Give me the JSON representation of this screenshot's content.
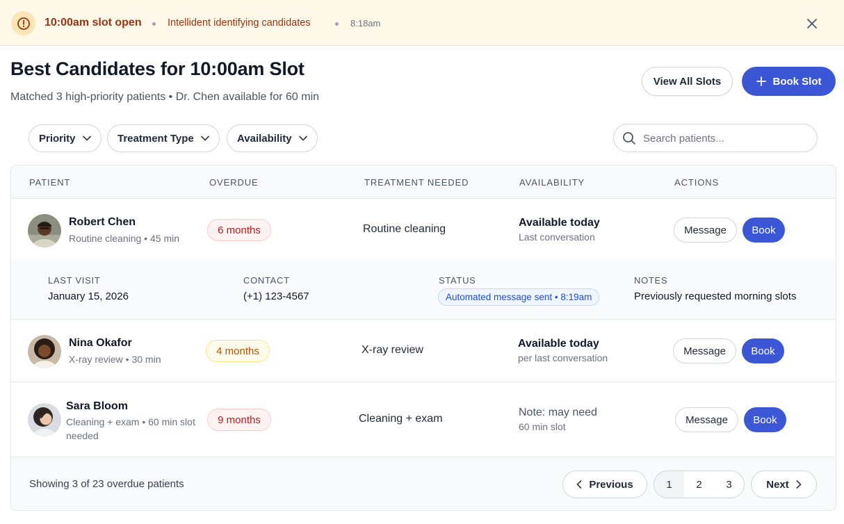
{
  "banner": {
    "title": "10:00am slot open",
    "subtitle": "Intellident identifying candidates",
    "time": "8:18am",
    "icon": "alert-circle-icon"
  },
  "header": {
    "title": "Best Candidates for 10:00am Slot",
    "subtitle": "Matched 3 high-priority patients • Dr. Chen available for 60 min",
    "view_all_label": "View All Slots",
    "book_slot_label": "Book Slot"
  },
  "filters": [
    {
      "label": "Priority"
    },
    {
      "label": "Treatment Type"
    },
    {
      "label": "Availability"
    }
  ],
  "search": {
    "placeholder": "Search patients..."
  },
  "table": {
    "columns": [
      "PATIENT",
      "OVERDUE",
      "TREATMENT NEEDED",
      "AVAILABILITY",
      "ACTIONS"
    ],
    "rows": [
      {
        "name": "Robert Chen",
        "meta": "Routine cleaning • 45 min",
        "overdue": "6 months",
        "treatment": "Routine cleaning",
        "availability": "Available today",
        "availability_note": "Last conversation",
        "message_label": "Message",
        "book_label": "Book"
      },
      {
        "name": "Nina Okafor",
        "meta": "X-ray review • 30 min",
        "overdue": "4 months",
        "treatment": "X-ray review",
        "availability": "Available today",
        "availability_note": "per last conversation",
        "message_label": "Message",
        "book_label": "Book"
      },
      {
        "name": "Sara Bloom",
        "meta": "Cleaning + exam • 60 min slot needed",
        "overdue": "9 months",
        "treatment": "Cleaning + exam",
        "availability": "Note: may need",
        "availability_note": "60 min slot",
        "message_label": "Message",
        "book_label": "Book"
      }
    ],
    "detail": {
      "last_visit_label": "LAST VISIT",
      "last_visit": "January 15, 2026",
      "contact_label": "CONTACT",
      "contact": "(+1) 123-4567",
      "status_label": "STATUS",
      "status": "Automated message sent • 8:19am",
      "notes_label": "NOTES",
      "notes": "Previously requested morning slots"
    }
  },
  "footer": {
    "showing": "Showing 3 of 23 overdue patients",
    "previous_label": "Previous",
    "pages": [
      "1",
      "2",
      "3"
    ],
    "next_label": "Next"
  },
  "colors": {
    "primary": "#3b57d6",
    "banner_bg": "#fef8e9",
    "banner_text": "#9a3412",
    "overdue_red": "#b91c1c",
    "overdue_amber": "#b45309",
    "status_blue": "#1d4ed8"
  }
}
